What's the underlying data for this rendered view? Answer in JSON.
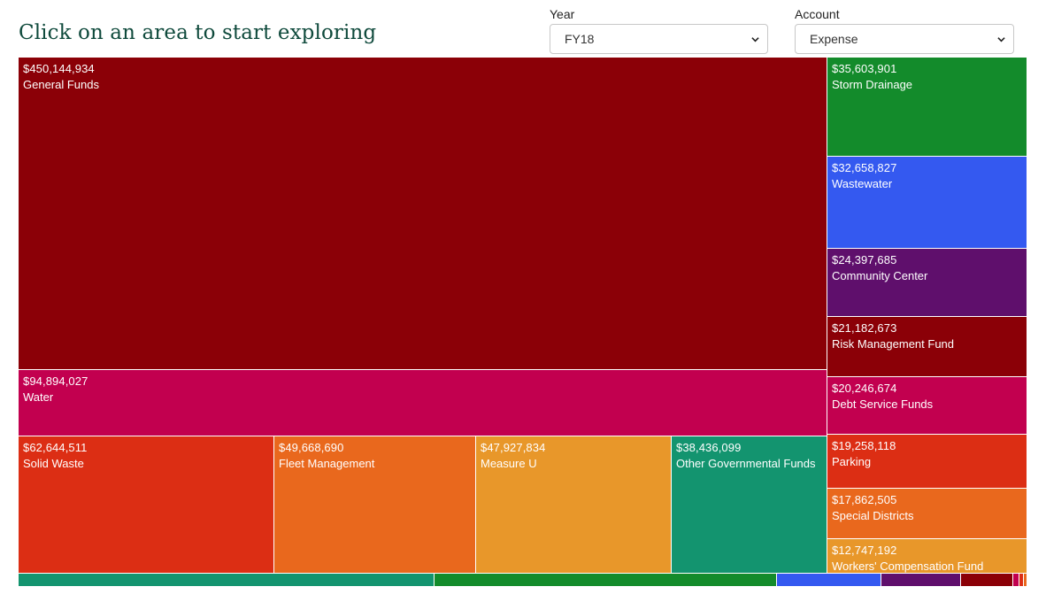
{
  "header": {
    "title": "Click on an area to start exploring",
    "year": {
      "label": "Year",
      "selected": "FY18"
    },
    "account": {
      "label": "Account",
      "selected": "Expense"
    }
  },
  "chart_data": {
    "type": "treemap",
    "tiles": [
      {
        "name": "General Funds",
        "value": 450144934,
        "label": "$450,144,934",
        "color": "#8b0007"
      },
      {
        "name": "Water",
        "value": 94894027,
        "label": "$94,894,027",
        "color": "#c2004f"
      },
      {
        "name": "Solid Waste",
        "value": 62644511,
        "label": "$62,644,511",
        "color": "#dc2e14"
      },
      {
        "name": "Fleet Management",
        "value": 49668690,
        "label": "$49,668,690",
        "color": "#e9681d"
      },
      {
        "name": "Measure U",
        "value": 47927834,
        "label": "$47,927,834",
        "color": "#e8972a"
      },
      {
        "name": "Other Governmental Funds",
        "value": 38436099,
        "label": "$38,436,099",
        "color": "#13946f"
      },
      {
        "name": "Storm Drainage",
        "value": 35603901,
        "label": "$35,603,901",
        "color": "#138b2b"
      },
      {
        "name": "Wastewater",
        "value": 32658827,
        "label": "$32,658,827",
        "color": "#3459f0"
      },
      {
        "name": "Community Center",
        "value": 24397685,
        "label": "$24,397,685",
        "color": "#5f0f6c"
      },
      {
        "name": "Risk Management Fund",
        "value": 21182673,
        "label": "$21,182,673",
        "color": "#8b0007"
      },
      {
        "name": "Debt Service Funds",
        "value": 20246674,
        "label": "$20,246,674",
        "color": "#c2004f"
      },
      {
        "name": "Parking",
        "value": 19258118,
        "label": "$19,258,118",
        "color": "#dc2e14"
      },
      {
        "name": "Special Districts",
        "value": 17862505,
        "label": "$17,862,505",
        "color": "#e9681d"
      },
      {
        "name": "Workers' Compensation Fund",
        "value": 12747192,
        "label": "$12,747,192",
        "color": "#e8972a"
      }
    ],
    "partial_tiles": [
      {
        "color": "#13946f"
      },
      {
        "color": "#138b2b"
      },
      {
        "color": "#3459f0"
      },
      {
        "color": "#5f0f6c"
      },
      {
        "color": "#8b0007"
      },
      {
        "color": "#c2004f"
      },
      {
        "color": "#dc2e14"
      },
      {
        "color": "#e9681d"
      }
    ]
  }
}
